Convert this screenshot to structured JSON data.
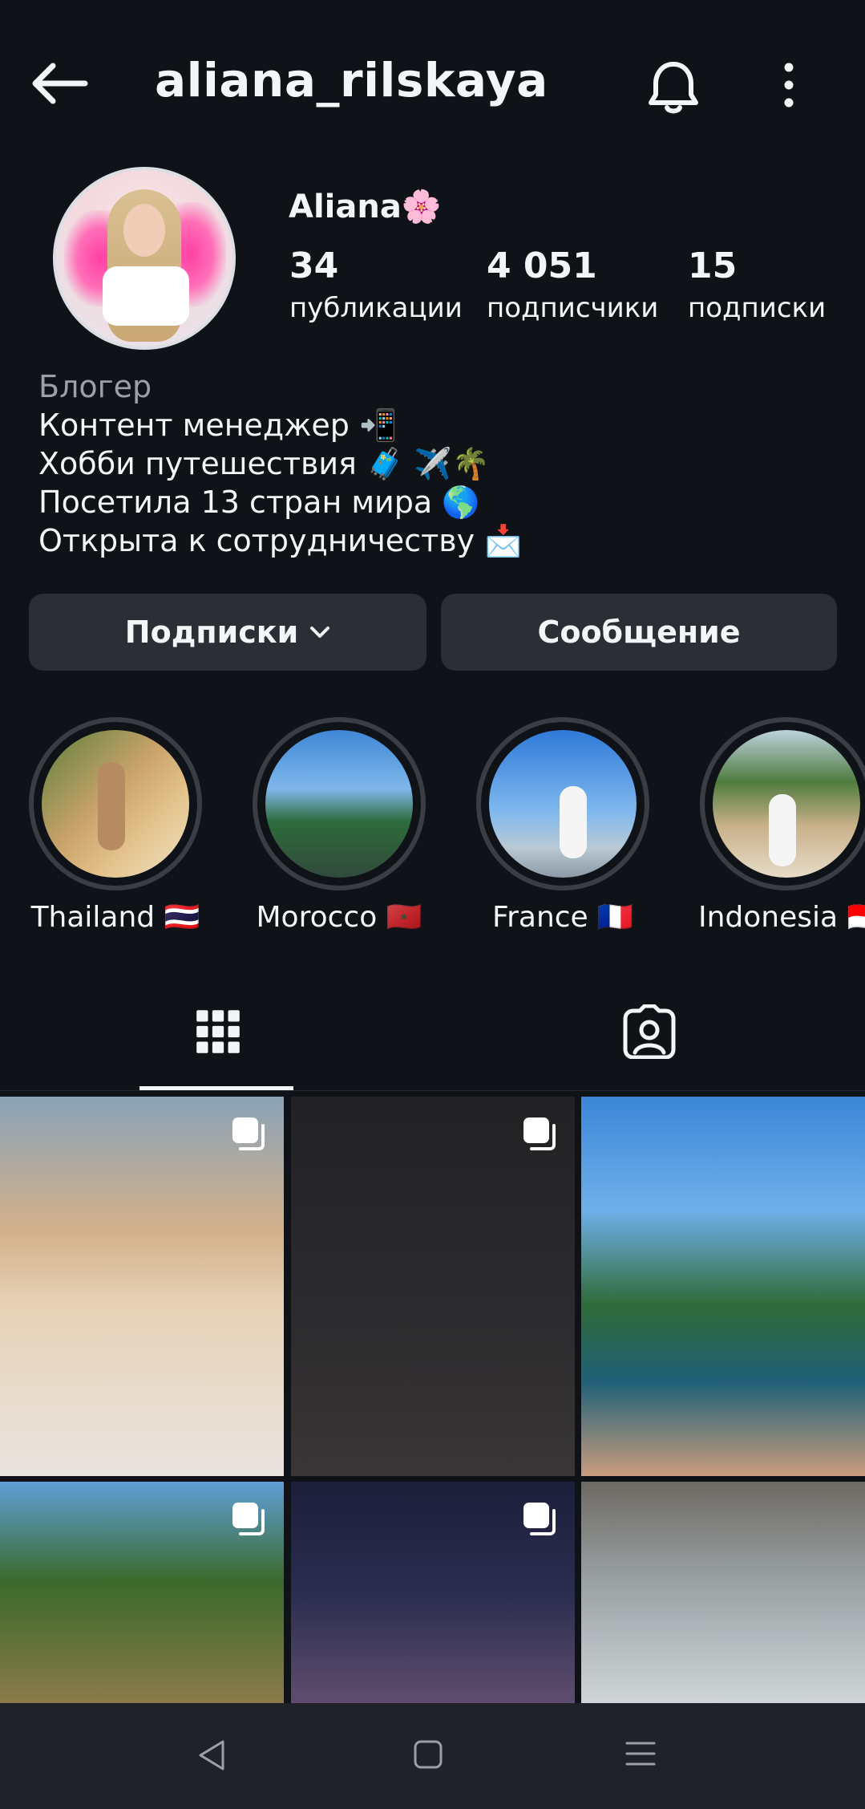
{
  "header": {
    "username": "aliana_rilskaya",
    "icons": [
      "arrow-left-icon",
      "bell-icon",
      "more-vertical-icon"
    ]
  },
  "profile": {
    "display_name": "Aliana🌸",
    "stats": [
      {
        "value": "34",
        "label": "публикации"
      },
      {
        "value": "4 051",
        "label": "подписчики"
      },
      {
        "value": "15",
        "label": "подписки"
      }
    ],
    "bio": {
      "category": "Блогер",
      "lines": [
        "Контент менеджер 📲",
        "Хобби путешествия 🧳 ✈️🌴",
        "Посетила 13 стран мира 🌎",
        "Открыта к сотрудничеству 📩"
      ]
    },
    "buttons": {
      "following": "Подписки",
      "message": "Сообщение"
    }
  },
  "highlights": [
    {
      "label": "Thailand 🇹🇭"
    },
    {
      "label": "Morocco 🇲🇦"
    },
    {
      "label": "France 🇫🇷"
    },
    {
      "label": "Indonesia 🇮🇩"
    }
  ],
  "tabs": [
    "grid-icon",
    "tagged-icon"
  ],
  "posts": [
    {
      "multi": true
    },
    {
      "multi": true
    },
    {
      "multi": false
    },
    {
      "multi": true
    },
    {
      "multi": true
    },
    {
      "multi": false
    }
  ],
  "colors": {
    "background": "#0f1217",
    "button": "#2b2f35",
    "text": "#f3f5f7",
    "muted": "#9aa0a6"
  }
}
